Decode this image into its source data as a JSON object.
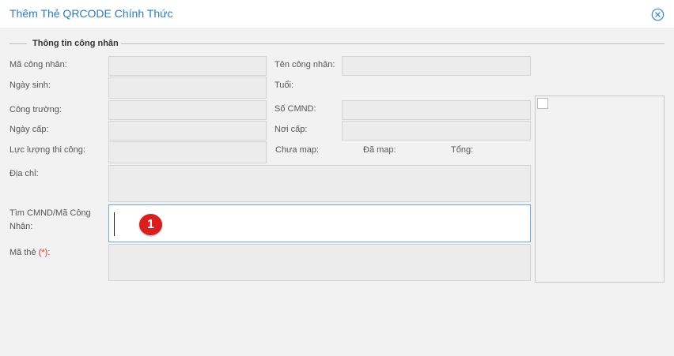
{
  "dialog": {
    "title": "Thêm Thẻ QRCODE Chính Thức"
  },
  "section": {
    "legend": "Thông tin công nhân"
  },
  "labels": {
    "ma_cong_nhan": "Mã công nhân:",
    "ten_cong_nhan": "Tên công nhân:",
    "ngay_sinh": "Ngày sinh:",
    "tuoi": "Tuổi:",
    "cong_truong": "Công trường:",
    "so_cmnd": "Số CMND:",
    "ngay_cap": "Ngày cấp:",
    "noi_cap": "Nơi cấp:",
    "luc_luong": "Lực lượng thi công:",
    "chua_map": "Chưa map:",
    "da_map": "Đã map:",
    "tong": "Tổng:",
    "dia_chi": "Địa chỉ:",
    "tim_cmnd_line1": "Tìm CMND/Mã Công",
    "tim_cmnd_line2": "Nhân:",
    "ma_the": "Mã thẻ",
    "ma_the_required": "(*)",
    "ma_the_colon": ":"
  },
  "values": {
    "ma_cong_nhan": "",
    "ten_cong_nhan": "",
    "ngay_sinh": "",
    "cong_truong": "",
    "so_cmnd": "",
    "ngay_cap": "",
    "noi_cap": "",
    "luc_luong": "",
    "dia_chi": "",
    "tim_cmnd": "",
    "ma_the": ""
  },
  "annotation": {
    "step_number": "1"
  },
  "icons": {
    "close": "close-circle-icon"
  },
  "colors": {
    "title": "#2b7bbd",
    "badge": "#d71f1f",
    "required": "#d9302c",
    "active_border": "#6aa6d6"
  }
}
